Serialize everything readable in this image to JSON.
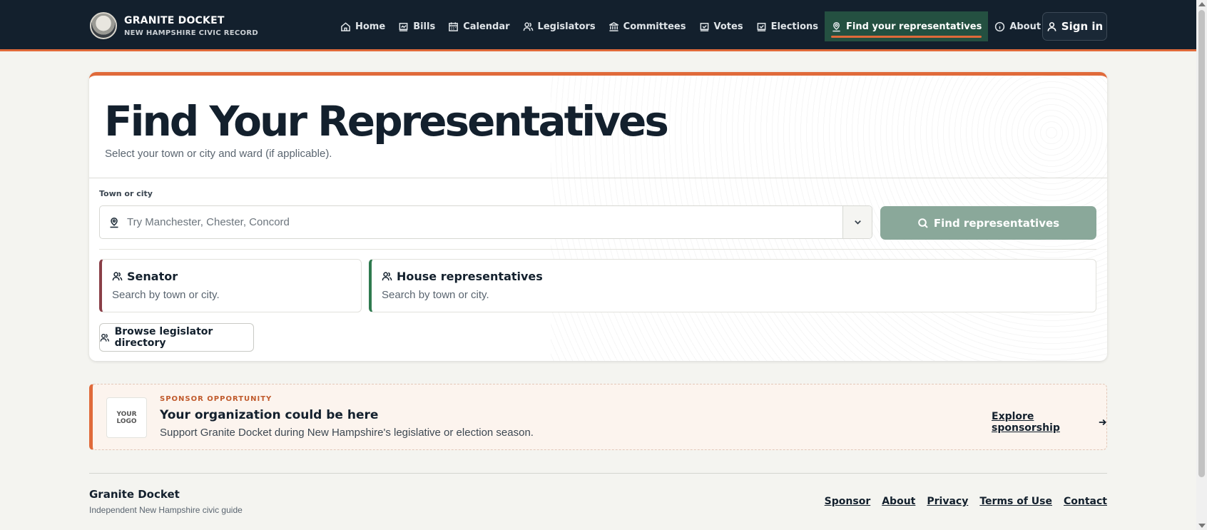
{
  "brand": {
    "title": "GRANITE DOCKET",
    "subtitle": "NEW HAMPSHIRE CIVIC RECORD"
  },
  "nav": {
    "items": [
      {
        "label": "Home",
        "icon": "home-icon"
      },
      {
        "label": "Bills",
        "icon": "bills-icon"
      },
      {
        "label": "Calendar",
        "icon": "calendar-icon"
      },
      {
        "label": "Legislators",
        "icon": "users-icon"
      },
      {
        "label": "Committees",
        "icon": "building-icon"
      },
      {
        "label": "Votes",
        "icon": "vote-icon"
      },
      {
        "label": "Elections",
        "icon": "ballot-icon"
      },
      {
        "label": "Find your representatives",
        "icon": "location-user-icon",
        "active": true
      },
      {
        "label": "About",
        "icon": "info-icon"
      }
    ],
    "signin_label": "Sign in"
  },
  "main": {
    "title": "Find Your Representatives",
    "subtitle": "Select your town or city and ward (if applicable).",
    "town_label": "Town or city",
    "town_placeholder": "Try Manchester, Chester, Concord",
    "town_value": "",
    "find_button": "Find representatives",
    "senator": {
      "title": "Senator",
      "desc": "Search by town or city."
    },
    "house": {
      "title": "House representatives",
      "desc": "Search by town or city."
    },
    "directory_button": "Browse legislator directory"
  },
  "sponsor": {
    "logo_text": "YOUR LOGO",
    "kicker": "SPONSOR OPPORTUNITY",
    "title": "Your organization could be here",
    "desc": "Support Granite Docket during New Hampshire's legislative or election season.",
    "link": "Explore sponsorship"
  },
  "footer": {
    "title": "Granite Docket",
    "subtitle": "Independent New Hampshire civic guide",
    "links": [
      "Sponsor",
      "About",
      "Privacy",
      "Terms of Use",
      "Contact"
    ]
  },
  "colors": {
    "header_bg": "#13202d",
    "accent": "#e06a3a",
    "active_nav": "#245041",
    "senator": "#8a3f48",
    "house": "#2f7a4f",
    "find_button": "#8aa89a"
  }
}
